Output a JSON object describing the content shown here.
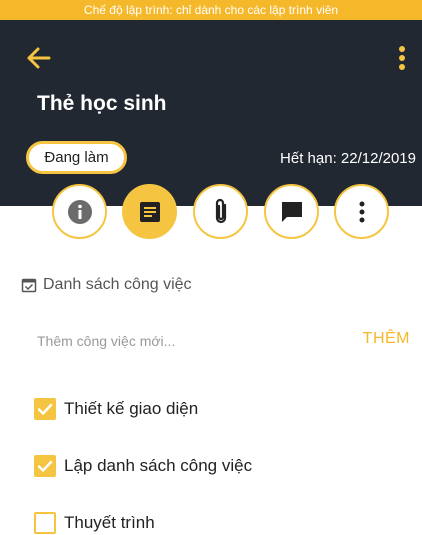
{
  "dev_banner": "Chế độ lập trình: chỉ dành cho các lập trình viên",
  "header": {
    "title": "Thẻ học sinh",
    "status": "Đang làm",
    "expiry": "Hết hạn: 22/12/2019"
  },
  "tabs": [
    {
      "icon": "info-icon",
      "active": false
    },
    {
      "icon": "note-icon",
      "active": true
    },
    {
      "icon": "attachment-icon",
      "active": false
    },
    {
      "icon": "comment-icon",
      "active": false
    },
    {
      "icon": "more-vertical-icon",
      "active": false
    }
  ],
  "checklist": {
    "heading": "Danh sách công việc",
    "input_placeholder": "Thêm công việc mới...",
    "add_label": "THÊM",
    "items": [
      {
        "label": "Thiết kế giao diện",
        "checked": true
      },
      {
        "label": "Lập danh sách công việc",
        "checked": true
      },
      {
        "label": "Thuyết trình",
        "checked": false
      }
    ]
  },
  "colors": {
    "accent": "#f5c542",
    "banner": "#f5b82a",
    "header_bg": "#222831"
  }
}
